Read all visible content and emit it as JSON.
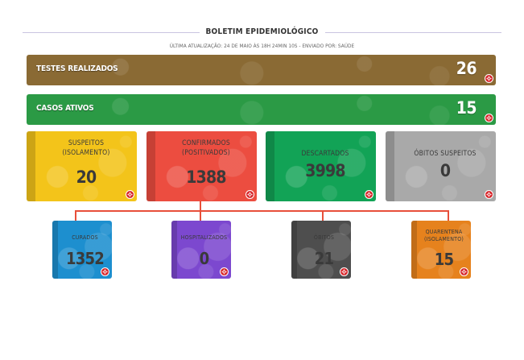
{
  "header": {
    "title": "BOLETIM EPIDEMIOLÓGICO",
    "subtitle": "ÚLTIMA ATUALIZAÇÃO: 24 DE MAIO ÀS 18H 24MIN 10S - ENVIADO POR: SAÚDE"
  },
  "bars": [
    {
      "label": "TESTES REALIZADOS",
      "value": "26",
      "color": "#8a6a34"
    },
    {
      "label": "CASOS ATIVOS",
      "value": "15",
      "color": "#2b9a45"
    }
  ],
  "cards": [
    {
      "title_line1": "SUSPEITOS",
      "title_line2": "(ISOLAMENTO)",
      "value": "20",
      "color": "#f3c41a"
    },
    {
      "title_line1": "CONFIRMADOS",
      "title_line2": "(POSITIVADOS)",
      "value": "1388",
      "color": "#ec4d40"
    },
    {
      "title_line1": "DESCARTADOS",
      "title_line2": "",
      "value": "3998",
      "color": "#12a356"
    },
    {
      "title_line1": "ÓBITOS SUSPEITOS",
      "title_line2": "",
      "value": "0",
      "color": "#a9a9a9"
    }
  ],
  "sub_cards": [
    {
      "title_line1": "CURADOS",
      "title_line2": "",
      "value": "1352",
      "color": "#1d8fcf"
    },
    {
      "title_line1": "HOSPITALIZADOS",
      "title_line2": "",
      "value": "0",
      "color": "#7c48cf"
    },
    {
      "title_line1": "ÓBITOS",
      "title_line2": "",
      "value": "21",
      "color": "#4e4e4e"
    },
    {
      "title_line1": "QUARENTENA",
      "title_line2": "(ISOLAMENTO)",
      "value": "15",
      "color": "#e6821d"
    }
  ],
  "icons": {
    "badge": "virus-badge-icon",
    "tree": "connector-lines"
  }
}
